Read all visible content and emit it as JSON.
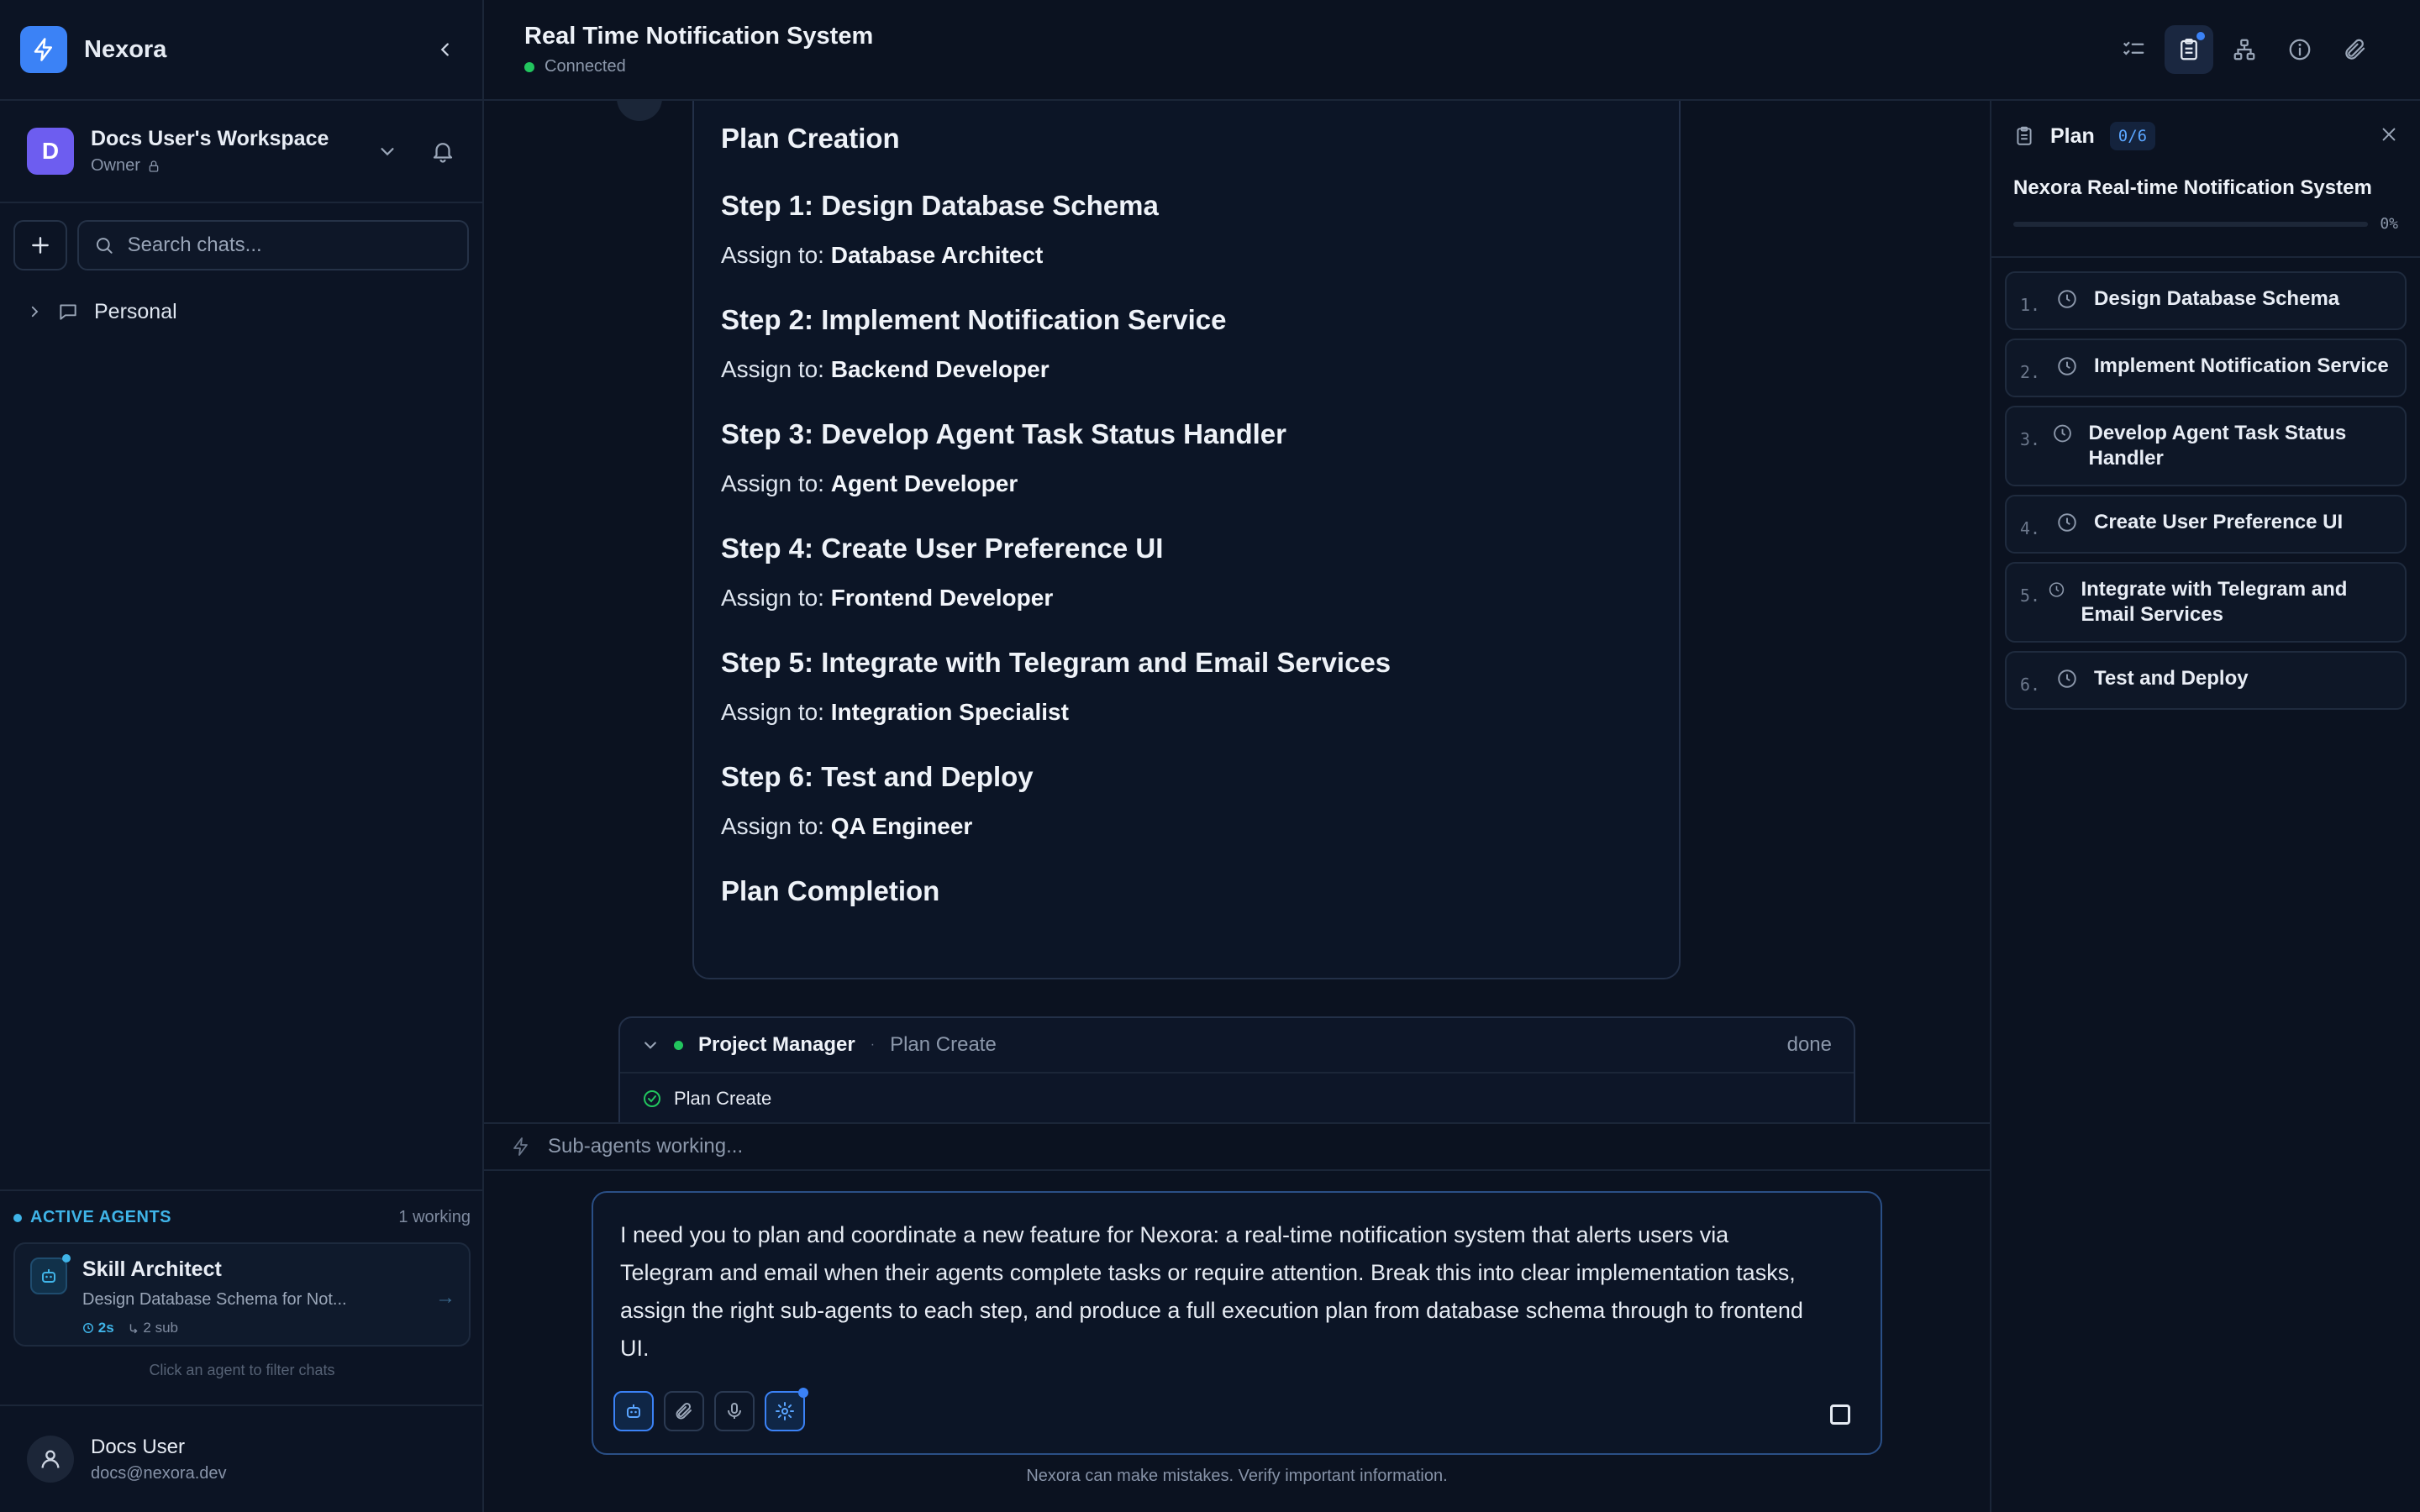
{
  "app": {
    "name": "Nexora"
  },
  "workspace": {
    "initial": "D",
    "name": "Docs User's Workspace",
    "role": "Owner"
  },
  "search": {
    "placeholder": "Search chats..."
  },
  "folders": [
    {
      "label": "Personal"
    }
  ],
  "active_agents": {
    "title": "ACTIVE AGENTS",
    "count": "1 working",
    "agent": {
      "name": "Skill Architect",
      "task": "Design Database Schema for Not...",
      "time": "2s",
      "sub": "2 sub"
    },
    "hint": "Click an agent to filter chats"
  },
  "user": {
    "name": "Docs User",
    "email": "docs@nexora.dev"
  },
  "chat": {
    "title": "Real Time Notification System",
    "status": "Connected"
  },
  "plan_card": {
    "heading": "Plan Creation",
    "assign_prefix": "Assign to:",
    "steps": [
      {
        "title": "Step 1: Design Database Schema",
        "assignee": "Database Architect"
      },
      {
        "title": "Step 2: Implement Notification Service",
        "assignee": "Backend Developer"
      },
      {
        "title": "Step 3: Develop Agent Task Status Handler",
        "assignee": "Agent Developer"
      },
      {
        "title": "Step 4: Create User Preference UI",
        "assignee": "Frontend Developer"
      },
      {
        "title": "Step 5: Integrate with Telegram and Email Services",
        "assignee": "Integration Specialist"
      },
      {
        "title": "Step 6: Test and Deploy",
        "assignee": "QA Engineer"
      }
    ],
    "footer": "Plan Completion"
  },
  "tool_call": {
    "agent": "Project Manager",
    "separator": "·",
    "action": "Plan Create",
    "status": "done",
    "row": "Plan Create"
  },
  "working_text": "Sub-agents working...",
  "composer": {
    "text": "I need you to plan and coordinate a new feature for Nexora: a real-time notification system that alerts users via Telegram and email when their agents complete tasks or require attention. Break this into clear implementation tasks, assign the right sub-agents to each step, and produce a full execution plan from database schema through to frontend UI."
  },
  "disclaimer": "Nexora can make mistakes. Verify important information.",
  "plan_panel": {
    "title": "Plan",
    "count": "0/6",
    "subtitle": "Nexora Real-time Notification System",
    "progress": 0,
    "progress_label": "0%",
    "steps": [
      {
        "num": "1.",
        "label": "Design Database Schema"
      },
      {
        "num": "2.",
        "label": "Implement Notification Service"
      },
      {
        "num": "3.",
        "label": "Develop Agent Task Status Handler"
      },
      {
        "num": "4.",
        "label": "Create User Preference UI"
      },
      {
        "num": "5.",
        "label": "Integrate with Telegram and Email Services"
      },
      {
        "num": "6.",
        "label": "Test and Deploy"
      }
    ]
  },
  "icons": {
    "logo": "lightning-icon",
    "collapse": "chevron-left-icon",
    "workspace_menu": "chevron-down-icon",
    "notifications": "bell-icon",
    "add": "plus-icon",
    "search": "search-icon",
    "folder_expand": "chevron-right-icon",
    "folder": "chat-bubble-icon",
    "agent": "robot-icon",
    "toolbar": [
      "checklist-icon",
      "clipboard-icon",
      "hierarchy-icon",
      "info-icon",
      "paperclip-icon"
    ],
    "composer": [
      "robot-icon",
      "paperclip-icon",
      "microphone-icon",
      "gear-icon"
    ],
    "step": "clock-icon"
  },
  "colors": {
    "accent": "#3b82f6",
    "connected": "#22c55e",
    "agents_title": "#3fb4e8"
  }
}
